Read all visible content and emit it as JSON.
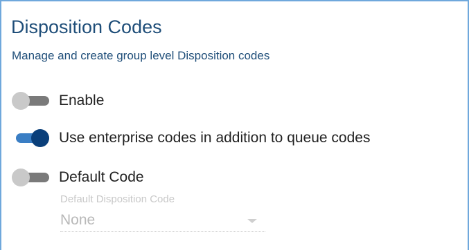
{
  "header": {
    "title": "Disposition Codes",
    "subtitle": "Manage and create group level Disposition codes"
  },
  "toggles": [
    {
      "label": "Enable",
      "enabled": false
    },
    {
      "label": "Use enterprise codes in addition to queue codes",
      "enabled": true
    },
    {
      "label": "Default Code",
      "enabled": false
    }
  ],
  "default_code_select": {
    "label": "Default Disposition Code",
    "value": "None",
    "disabled": true
  },
  "colors": {
    "title": "#1f4e79",
    "toggle_on_thumb": "#0a3f7a",
    "toggle_on_track": "#3a7ec4",
    "toggle_off_thumb": "#c9c9c9",
    "toggle_off_track": "#7a7a7a",
    "panel_border": "#6fa8dc"
  }
}
